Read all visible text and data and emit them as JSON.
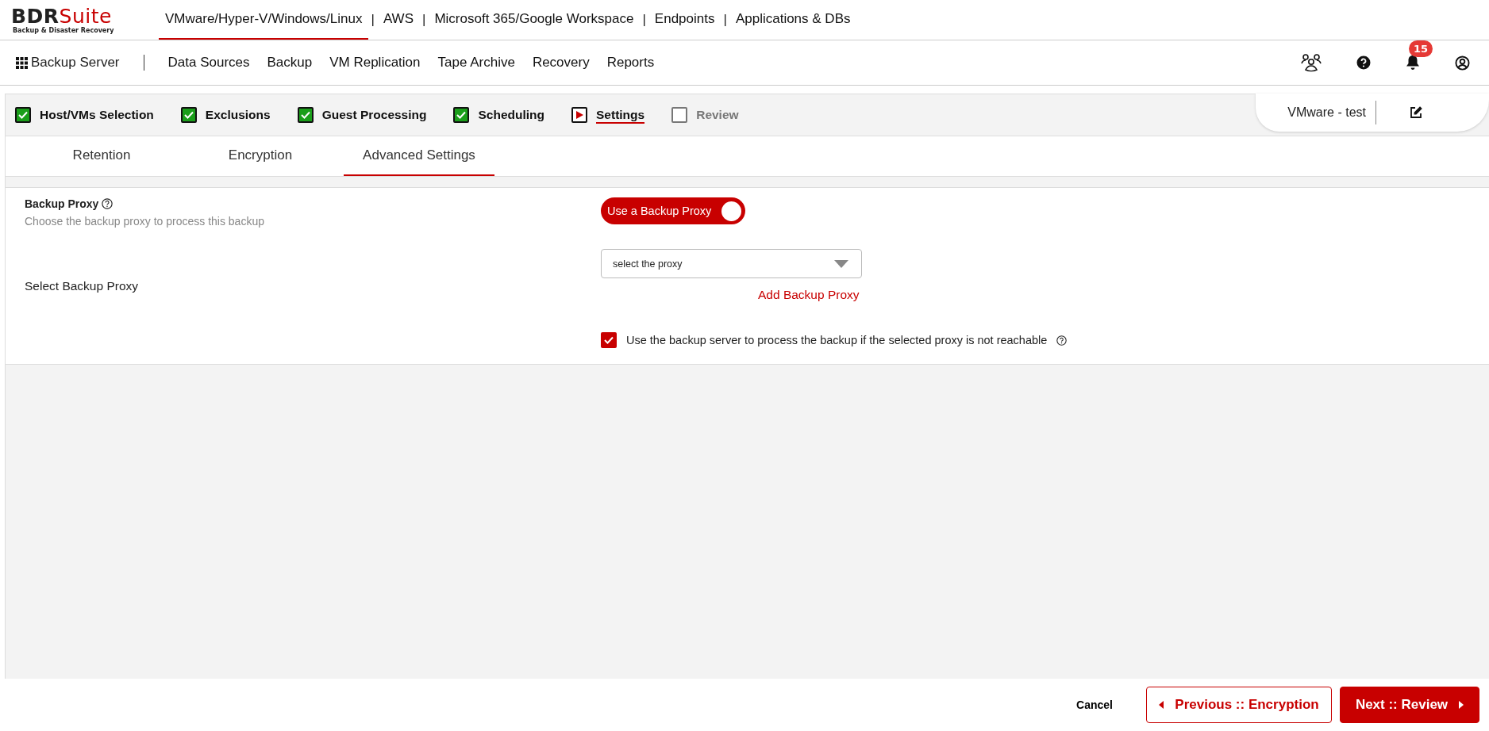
{
  "logo": {
    "name_dark": "BDR",
    "name_accent": "Suite",
    "tagline": "Backup & Disaster Recovery"
  },
  "product_tabs": [
    {
      "label": "VMware/Hyper-V/Windows/Linux",
      "selected": true
    },
    {
      "separator": "|",
      "label": "AWS",
      "selected": false
    },
    {
      "separator": "|",
      "label": "Microsoft 365/Google Workspace",
      "selected": false
    },
    {
      "separator": "|",
      "label": "Endpoints",
      "selected": false
    },
    {
      "separator": "|",
      "label": "Applications & DBs",
      "selected": false
    }
  ],
  "app_title": "Backup Server",
  "nav_menu": [
    "Data Sources",
    "Backup",
    "VM Replication",
    "Tape Archive",
    "Recovery",
    "Reports"
  ],
  "notifications": {
    "count": "15"
  },
  "wizard_steps": [
    {
      "label": "Host/VMs Selection",
      "checked": true,
      "selected": false
    },
    {
      "label": "Exclusions",
      "checked": true,
      "selected": false
    },
    {
      "label": "Guest Processing",
      "checked": true,
      "selected": false
    },
    {
      "label": "Scheduling",
      "checked": true,
      "selected": false
    },
    {
      "label": "Settings",
      "checked": false,
      "selected": true
    },
    {
      "label": "Review",
      "checked": false,
      "selected": false
    }
  ],
  "job_name": "VMware - test",
  "sub_tabs": [
    {
      "label": "Retention",
      "selected": false
    },
    {
      "label": "Encryption",
      "selected": false
    },
    {
      "label": "Advanced Settings",
      "selected": true
    }
  ],
  "backup_proxy": {
    "title": "Backup Proxy",
    "description": "Choose the backup proxy to process this backup",
    "toggle_label": "Use a Backup Proxy",
    "on": true
  },
  "select_proxy": {
    "label": "Select Backup Proxy",
    "placeholder": "select the proxy",
    "add_link": "Add Backup Proxy"
  },
  "fallback": {
    "label": "Use the backup server to process the backup if the selected proxy is not reachable",
    "checked": true
  },
  "footer": {
    "cancel": "Cancel",
    "previous": "Previous :: Encryption",
    "next": "Next :: Review"
  }
}
